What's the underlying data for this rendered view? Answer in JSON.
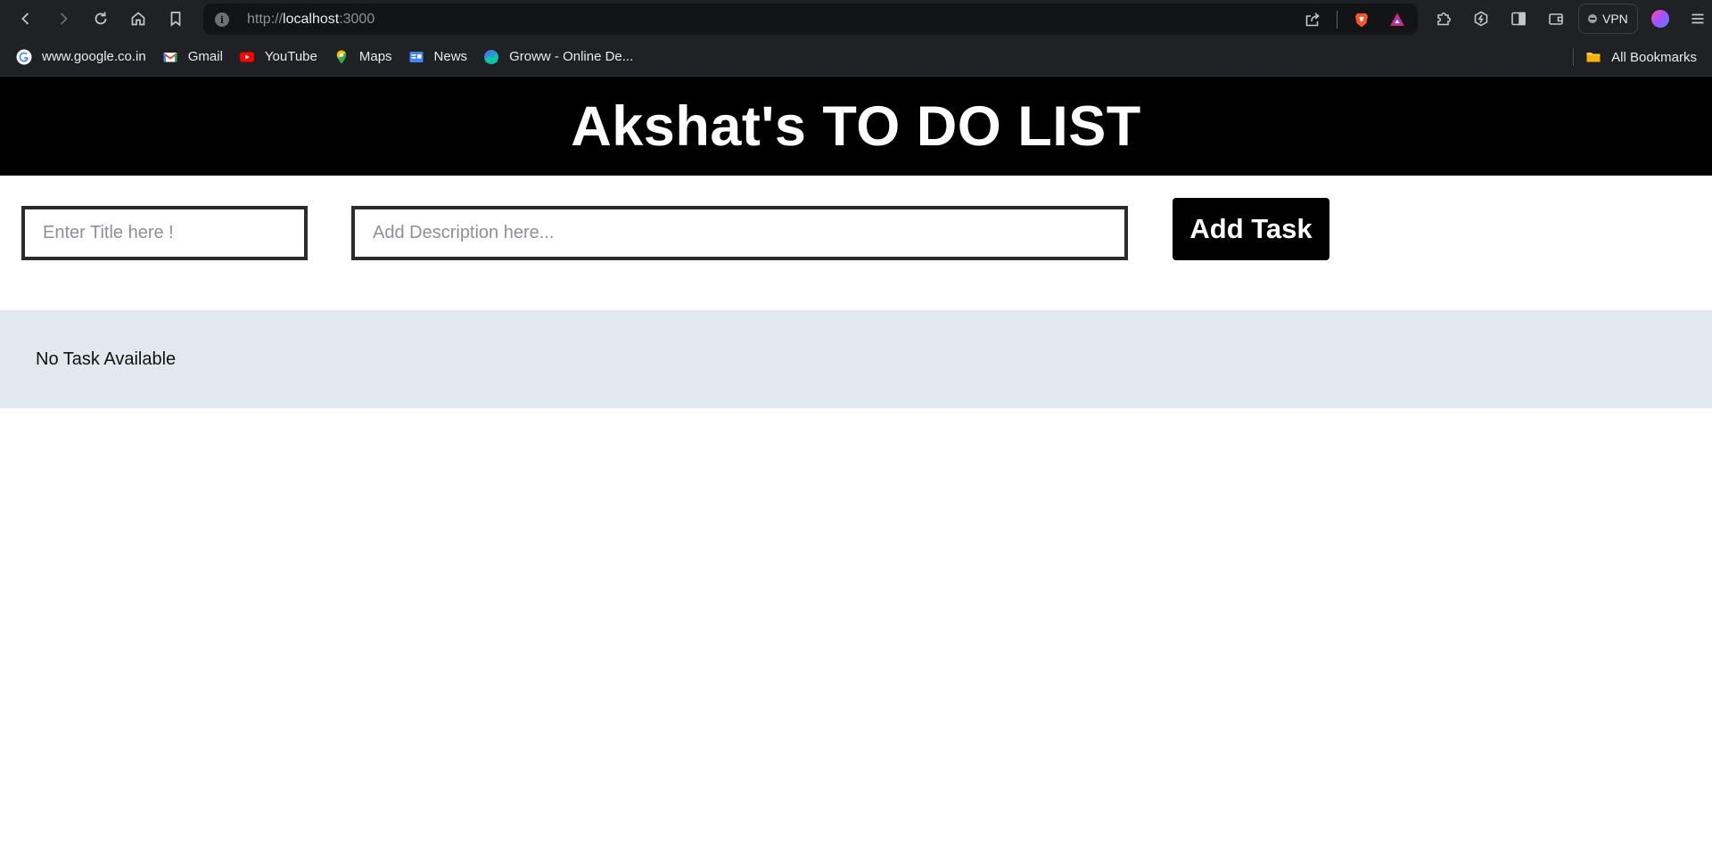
{
  "browser": {
    "url_scheme": "http://",
    "url_host": "localhost",
    "url_port": ":3000",
    "vpn_label": "VPN",
    "bookmarks": [
      {
        "label": "www.google.co.in",
        "icon": "google-icon"
      },
      {
        "label": "Gmail",
        "icon": "gmail-icon"
      },
      {
        "label": "YouTube",
        "icon": "youtube-icon"
      },
      {
        "label": "Maps",
        "icon": "maps-icon"
      },
      {
        "label": "News",
        "icon": "news-icon"
      },
      {
        "label": "Groww - Online De...",
        "icon": "groww-icon"
      }
    ],
    "all_bookmarks_label": "All Bookmarks"
  },
  "app": {
    "title": "Akshat's TO DO LIST",
    "title_placeholder": "Enter Title here !",
    "description_placeholder": "Add Description here...",
    "add_button_label": "Add Task",
    "empty_message": "No Task Available"
  },
  "colors": {
    "header_bg": "#000000",
    "task_area_bg": "#e2e8f0",
    "button_bg": "#000000"
  }
}
